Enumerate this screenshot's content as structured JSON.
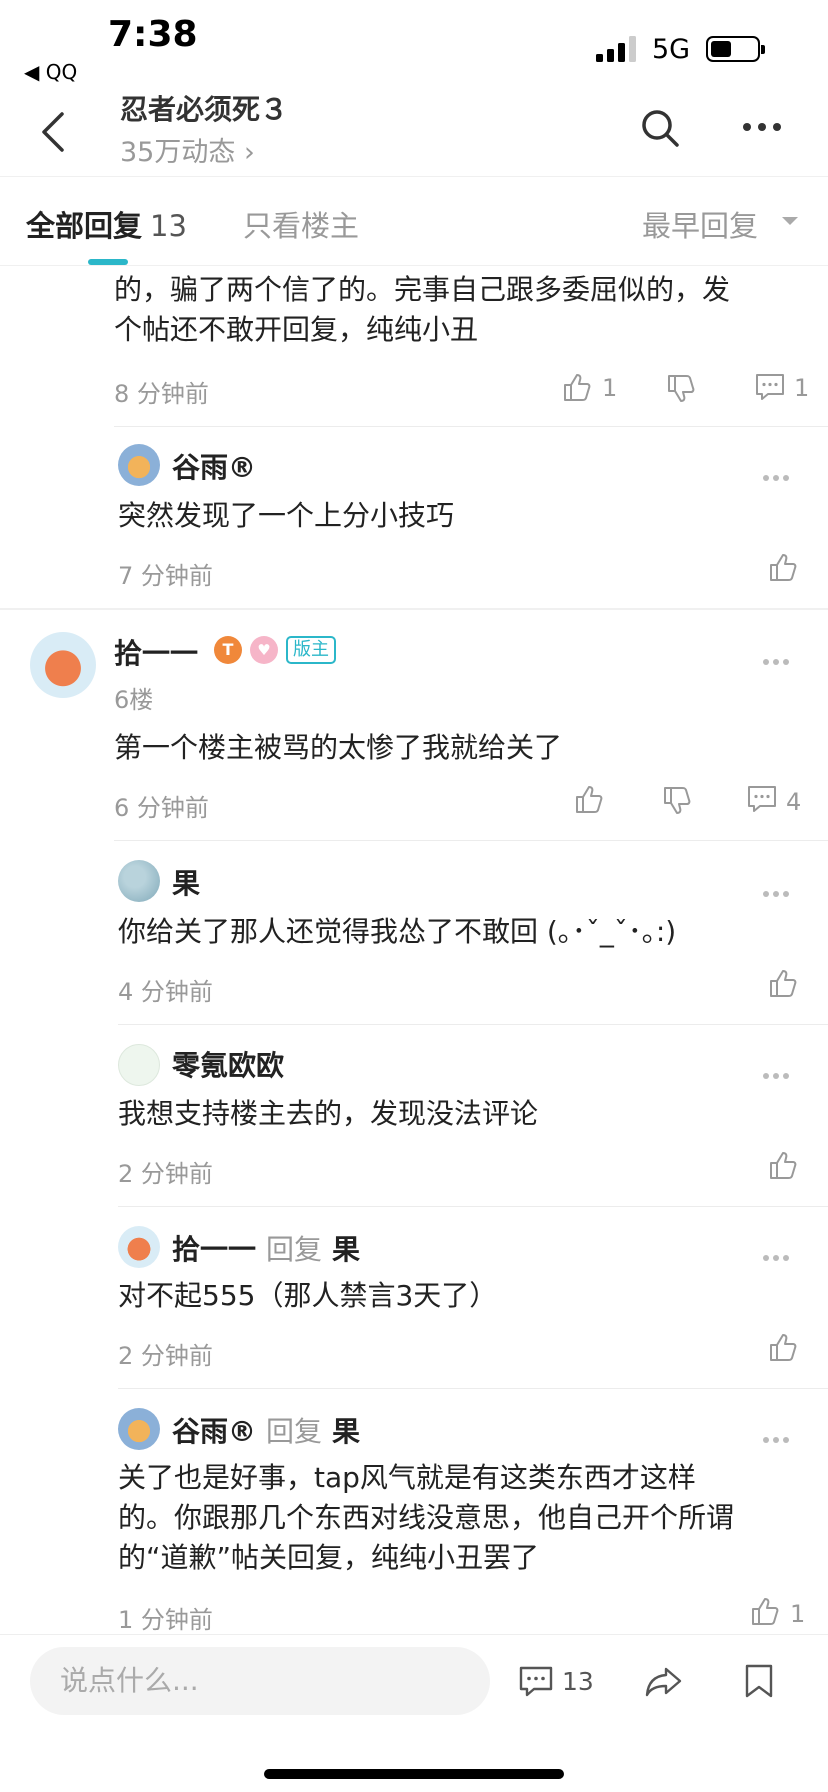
{
  "status_bar": {
    "time": "7:38",
    "back_app": "◀ QQ",
    "network": "5G"
  },
  "header": {
    "title": "忍者必须死３",
    "subtitle": "35万动态 ›"
  },
  "tabs": {
    "all_label": "全部回复",
    "all_count": "13",
    "op_only": "只看楼主",
    "sort": "最早回复"
  },
  "feed": {
    "partial_reply": {
      "line1": "的，骗了两个信了的。完事自己跟多委屈似的，发",
      "line2": "个帖还不敢开回复，纯纯小丑",
      "time": "8 分钟前",
      "likes": "1",
      "comments": "1"
    },
    "sub_reply_1": {
      "name": "谷雨®",
      "text": "突然发现了一个上分小技巧",
      "time": "7 分钟前"
    },
    "post": {
      "name": "拾一一",
      "badge_t": "T",
      "badge_mod": "版主",
      "floor": "6楼",
      "text": "第一个楼主被骂的太惨了我就给关了",
      "time": "6 分钟前",
      "comments": "4"
    },
    "replies": [
      {
        "name": "果",
        "text": "你给关了那人还觉得我怂了不敢回 (｡･ˇ_ˇ･｡:)",
        "time": "4 分钟前"
      },
      {
        "name": "零氪欧欧",
        "text": "我想支持楼主去的，发现没法评论",
        "time": "2 分钟前"
      },
      {
        "name": "拾一一",
        "reply_word": "回复",
        "target": "果",
        "text": "对不起555（那人禁言3天了）",
        "time": "2 分钟前"
      },
      {
        "name": "谷雨®",
        "reply_word": "回复",
        "target": "果",
        "line1": "关了也是好事，tap风气就是有这类东西才这样",
        "line2": "的。你跟那几个东西对线没意思，他自己开个所谓",
        "line3": "的“道歉”帖关回复，纯纯小丑罢了",
        "time": "1 分钟前",
        "likes": "1"
      }
    ]
  },
  "bottom_bar": {
    "input_placeholder": "说点什么...",
    "comment_count": "13"
  },
  "colors": {
    "accent": "#2bb7c9",
    "muted": "#999999",
    "text": "#222222"
  }
}
